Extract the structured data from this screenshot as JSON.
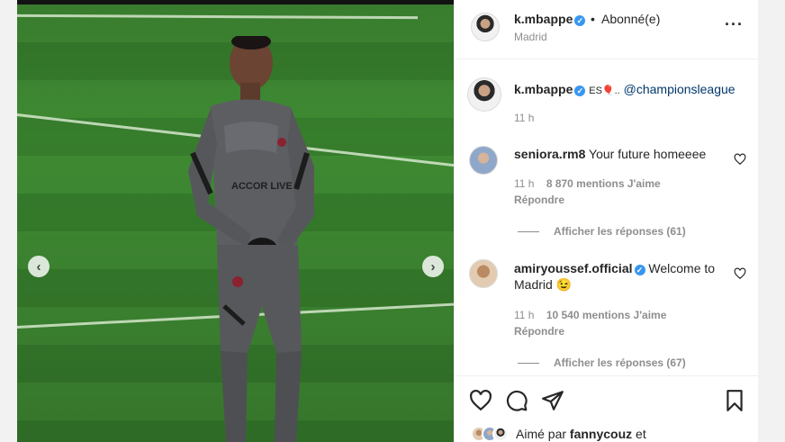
{
  "post": {
    "author": "k.mbappe",
    "follow_status": "Abonné(e)",
    "separator": "•",
    "location": "Madrid",
    "more_label": "•••"
  },
  "caption": {
    "author": "k.mbappe",
    "emoji_text": "ES🎈..",
    "mention": "@championsleague",
    "time": "11 h"
  },
  "comments": [
    {
      "author": "seniora.rm8",
      "text": "Your future homeeee",
      "time": "11 h",
      "likes": "8 870 mentions J'aime",
      "reply_label": "Répondre",
      "view_replies": "Afficher les réponses (61)"
    },
    {
      "author": "amiryoussef.official",
      "text": "Welcome to Madrid 😉",
      "time": "11 h",
      "likes": "10 540 mentions J'aime",
      "reply_label": "Répondre",
      "view_replies": "Afficher les réponses (67)"
    }
  ],
  "liked_by": {
    "prefix": "Aimé par",
    "user": "fannycouz",
    "suffix": "et"
  },
  "icons": {
    "verified": "✓",
    "prev": "‹",
    "next": "›"
  },
  "colors": {
    "verified_blue": "#3897f0",
    "link": "#00376b",
    "muted": "#8e8e8e"
  }
}
